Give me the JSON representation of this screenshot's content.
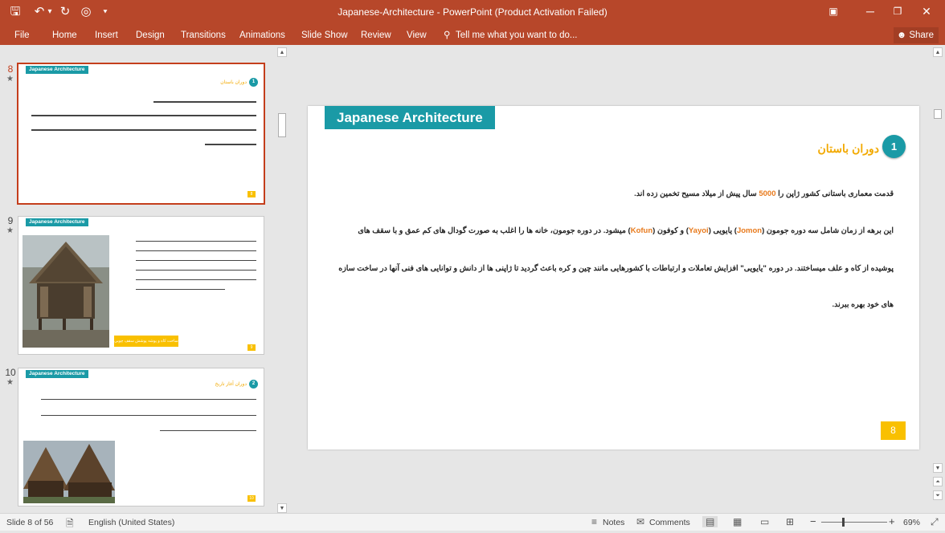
{
  "window": {
    "title": "Japanese-Architecture - PowerPoint (Product Activation Failed)",
    "minimize": "─",
    "restore": "❐",
    "close": "✕",
    "ribbon_display": "▣"
  },
  "qat": {
    "save": "🖫",
    "undo": "↶",
    "undo_dropdown": "▾",
    "redo": "↻",
    "present": "◎",
    "customize": "⯆"
  },
  "ribbon": {
    "tabs": [
      "File",
      "Home",
      "Insert",
      "Design",
      "Transitions",
      "Animations",
      "Slide Show",
      "Review",
      "View"
    ],
    "tell_me": "Tell me what you want to do...",
    "share": "Share"
  },
  "thumbnails": [
    {
      "number": "8",
      "header": "Japanese Architecture",
      "subtitle": "دوران باستان",
      "circle": "1",
      "page": "8"
    },
    {
      "number": "9",
      "header": "Japanese Architecture",
      "caption": "ساخت کاه و پوشه پوشش سقف چوبی",
      "page": "9"
    },
    {
      "number": "10",
      "header": "Japanese Architecture",
      "subtitle": "دوران آغاز تاریخ",
      "circle": "2",
      "page": "10"
    }
  ],
  "slide": {
    "header": "Japanese Architecture",
    "subtitle": "دوران باستان",
    "circle": "1",
    "para1_a": "قدمت معماری باستانی کشور ژاپن را",
    "para1_num": "5000",
    "para1_b": "سال پیش از میلاد مسیح تخمین زده اند.",
    "para2_a": "این برهه از زمان شامل سه دوره جومون (",
    "para2_jomon": "Jomon",
    "para2_b": ") یایویی (",
    "para2_yayoi": "Yayoi",
    "para2_c": ") و کوفون (",
    "para2_kofun": "Kofun",
    "para2_d": ") میشود. در دوره جومون، خانه ها را اغلب به صورت گودال های کم عمق و با سقف های",
    "para3": "پوشیده از کاه و علف میساختند. در دوره \"یایویی\" افزایش تعاملات و ارتباطات با کشورهایی مانند چین و کره باعث گردید تا ژاپنی ها از دانش و توانایی های فنی آنها در ساخت سازه",
    "para4": "های خود بهره ببرند.",
    "page": "8"
  },
  "status": {
    "slide_info": "Slide 8 of 56",
    "language": "English (United States)",
    "notes": "Notes",
    "comments": "Comments",
    "zoom_minus": "−",
    "zoom_plus": "+",
    "zoom_level": "69%",
    "zoom_fraction": 0.69
  },
  "colors": {
    "accent": "#b7472a",
    "teal": "#1a9aa6",
    "gold": "#f2a900",
    "badge": "#f9c000",
    "highlight": "#e87a1c"
  }
}
